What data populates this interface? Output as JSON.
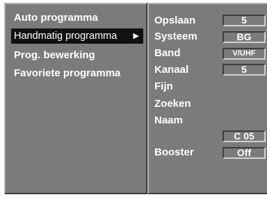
{
  "main_menu": {
    "items": [
      {
        "label": "Auto programma"
      },
      {
        "label": "Handmatig programma",
        "selected": true,
        "arrow": "▶"
      },
      {
        "label": "Prog. bewerking"
      },
      {
        "label": "Favoriete programma"
      }
    ]
  },
  "submenu": {
    "rows": [
      {
        "label": "Opslaan",
        "value": "5"
      },
      {
        "label": "Systeem",
        "value": "BG"
      },
      {
        "label": "Band",
        "value": "V/UHF"
      },
      {
        "label": "Kanaal",
        "value": "5"
      },
      {
        "label": "Fijn"
      },
      {
        "label": "Zoeken"
      },
      {
        "label": "Naam"
      },
      {
        "label": "",
        "value": "C 05"
      },
      {
        "label": "Booster",
        "value": "Off"
      }
    ]
  },
  "colors": {
    "panel_background": "#7b7b7b",
    "selection_background": "#111111",
    "text": "#ffffff"
  }
}
